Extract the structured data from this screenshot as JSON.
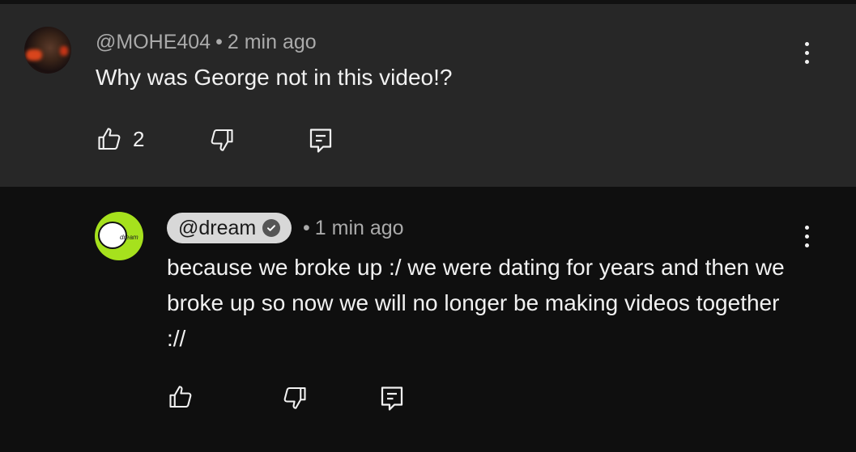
{
  "comments": [
    {
      "author": "@MOHE404",
      "time": "2 min ago",
      "separator": "•",
      "text": "Why was George not in this video!?",
      "likes": "2",
      "icons": {
        "like": "thumbs-up-icon",
        "dislike": "thumbs-down-icon",
        "reply": "reply-icon",
        "more": "more-vert-icon"
      }
    },
    {
      "author": "@dream",
      "verified": true,
      "time": "1 min ago",
      "separator": "•",
      "text": "because we broke up :/ we were dating for years and then we broke up so now we will no longer be making videos together ://",
      "avatar_brand": "dream",
      "icons": {
        "like": "thumbs-up-icon",
        "dislike": "thumbs-down-icon",
        "reply": "reply-icon",
        "more": "more-vert-icon",
        "verified": "checkmark-icon"
      }
    }
  ],
  "colors": {
    "top_bg": "#272727",
    "reply_bg": "#0f0f0f",
    "text_primary": "#f1f1f1",
    "text_secondary": "#aaaaaa",
    "author_pill_bg": "#d8d8d8",
    "reply_avatar": "#a6e11d"
  }
}
